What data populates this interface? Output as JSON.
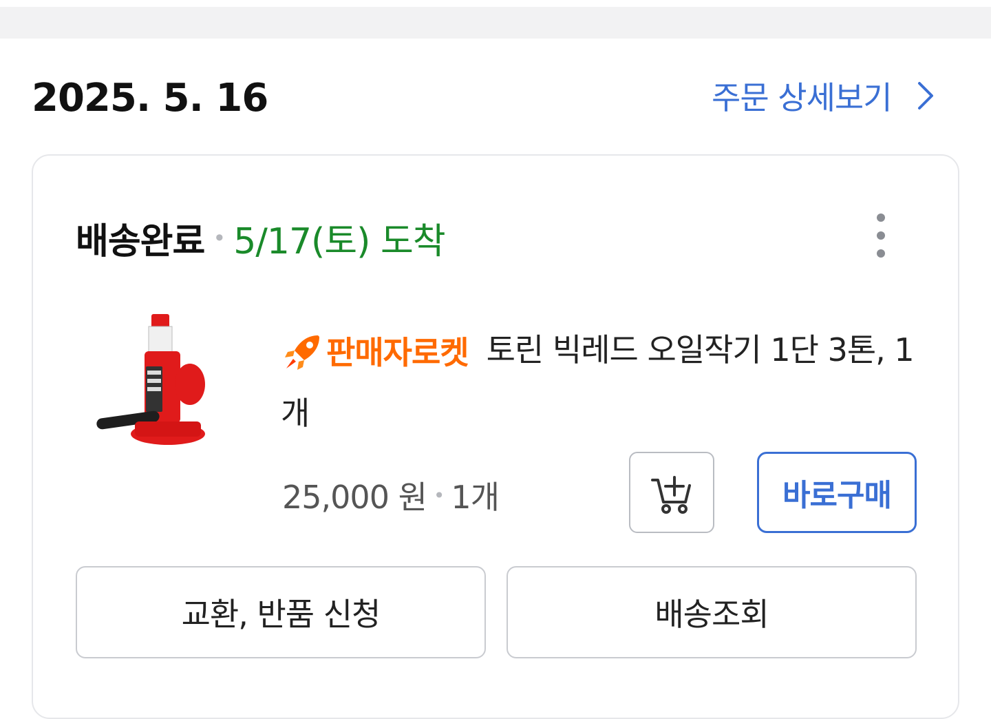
{
  "order": {
    "date": "2025. 5. 16",
    "detail_link": "주문 상세보기"
  },
  "card": {
    "status": "배송완료",
    "arrival": "5/17(토) 도착",
    "product": {
      "badge": "판매자로켓",
      "title": "토린 빅레드 오일작기 1단 3톤, 1개",
      "price": "25,000 원",
      "quantity": "1개"
    },
    "buy_now_label": "바로구매",
    "return_label": "교환, 반품 신청",
    "tracking_label": "배송조회"
  },
  "colors": {
    "accent_blue": "#3a6fd4",
    "arrival_green": "#1a8a2a",
    "rocket_orange": "#ff6a00"
  }
}
